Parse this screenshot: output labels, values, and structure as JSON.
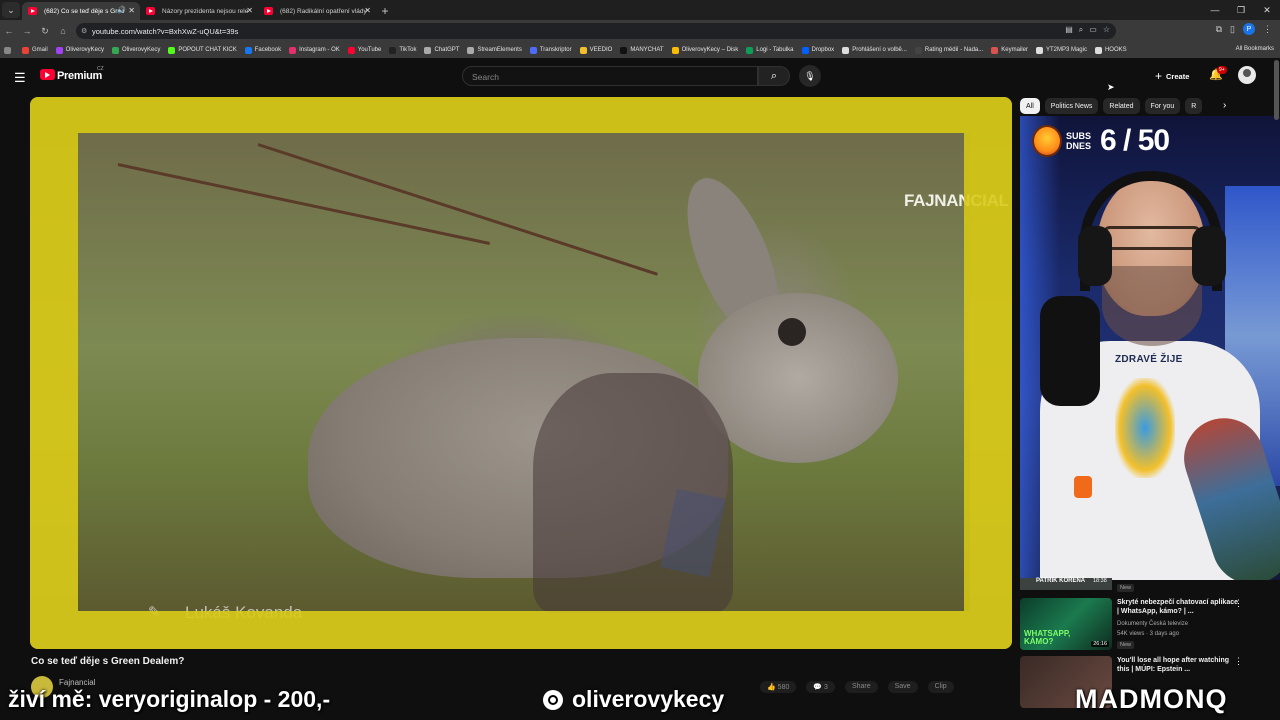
{
  "browser": {
    "tabs": [
      {
        "label": "(682) Co se teď děje s Gree",
        "active": true,
        "audio": true
      },
      {
        "label": "Názory prezidenta nejsou rele",
        "active": false,
        "audio": false
      },
      {
        "label": "(682) Radikální opatření vlády",
        "active": false,
        "audio": false
      }
    ],
    "url": "youtube.com/watch?v=BxhXwZ-uQU&t=39s",
    "profile_letter": "P",
    "bookmarks": [
      {
        "label": "Gmail",
        "color": "#ea4335"
      },
      {
        "label": "OliverovyKecy",
        "color": "#a142f4"
      },
      {
        "label": "OliverovyKecy",
        "color": "#34a853"
      },
      {
        "label": "POPOUT CHAT KICK",
        "color": "#53fc18"
      },
      {
        "label": "Facebook",
        "color": "#1877f2"
      },
      {
        "label": "Instagram - OK",
        "color": "#e1306c"
      },
      {
        "label": "YouTube",
        "color": "#ff0033"
      },
      {
        "label": "TikTok",
        "color": "#222222"
      },
      {
        "label": "ChatGPT",
        "color": "#aaaaaa"
      },
      {
        "label": "StreamElements",
        "color": "#aaaaaa"
      },
      {
        "label": "Transkriptor",
        "color": "#4d6cfa"
      },
      {
        "label": "VEEDIO",
        "color": "#f2c02c"
      },
      {
        "label": "MANYCHAT",
        "color": "#111111"
      },
      {
        "label": "OliverovyKecy – Disk",
        "color": "#fbbc04"
      },
      {
        "label": "Logi - Tabulka",
        "color": "#0f9d58"
      },
      {
        "label": "Dropbox",
        "color": "#0061ff"
      },
      {
        "label": "Prohlášení o volbě...",
        "color": "#dddddd"
      },
      {
        "label": "Rating médií - Nada...",
        "color": "#444444"
      },
      {
        "label": "Keymailer",
        "color": "#d9534f"
      },
      {
        "label": "YT2MP3 Magic",
        "color": "#e0e0e0"
      },
      {
        "label": "HOOKS",
        "color": "#dddddd"
      }
    ],
    "all_bookmarks": "All Bookmarks"
  },
  "youtube": {
    "brand": "Premium",
    "country": "CZ",
    "search_placeholder": "Search",
    "create_label": "Create",
    "notification_badge": "9+",
    "chips": [
      "All",
      "Politics News",
      "Related",
      "For you",
      "R"
    ],
    "video": {
      "watermark": "FAJNANCIAL",
      "lower_third": "Lukáš Kovanda",
      "title": "Co se teď děje s Green Dealem?",
      "channel": "Fajnancial",
      "likes": "580",
      "comments": "3",
      "share": "Share",
      "save": "Save",
      "clip": "Clip"
    },
    "webcam": {
      "subs_label": "SUBS DNES",
      "subs_count": "6 / 50",
      "shirt_text": "ZDRAVÉ ŽIJE"
    },
    "recommendations": [
      {
        "channel_strip": "PATRIK KOŘENÁ",
        "duration": "18:38",
        "badge": "New"
      },
      {
        "title": "Skryté nebezpečí chatovací aplikace | WhatsApp, kámo? | ...",
        "channel": "Dokumenty Česká televize",
        "meta": "54K views · 3 days ago",
        "badge": "New",
        "duration": "26:16",
        "thumb_text": "WHATSAPP, KÁMO?"
      },
      {
        "title": "You'll lose all hope after watching this | MÚPI: Epstein ..."
      }
    ]
  },
  "overlay": {
    "left": "živí mě: veryoriginalop - 200,-",
    "handle": "oliverovykecy",
    "brand": "MADMONQ"
  }
}
